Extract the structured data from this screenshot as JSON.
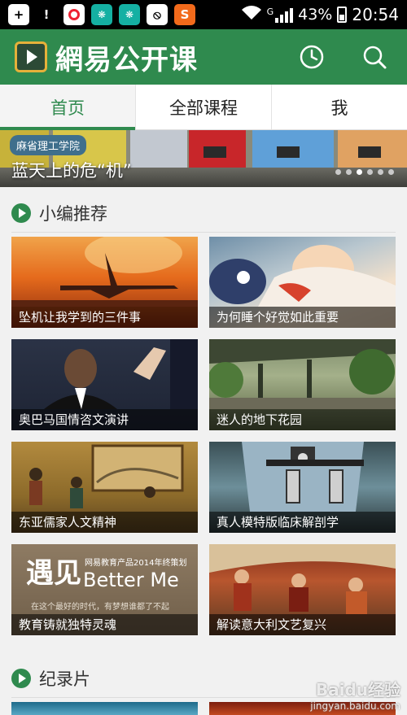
{
  "status_bar": {
    "battery": "43%",
    "time": "20:54",
    "signal_label": "G"
  },
  "app": {
    "title": "網易公开课",
    "icons": [
      "history-icon",
      "search-icon"
    ]
  },
  "tabs": [
    {
      "label": "首页",
      "active": true
    },
    {
      "label": "全部课程",
      "active": false
    },
    {
      "label": "我",
      "active": false
    }
  ],
  "banner": {
    "tag": "麻省理工学院",
    "title": "蓝天上的危“机”",
    "dots": 6,
    "active_dot": 3
  },
  "sections": [
    {
      "title": "小编推荐",
      "items": [
        {
          "caption": "坠机让我学到的三件事"
        },
        {
          "caption": "为何睡个好觉如此重要"
        },
        {
          "caption": "奥巴马国情咨文演讲"
        },
        {
          "caption": "迷人的地下花园"
        },
        {
          "caption": "东亚儒家人文精神"
        },
        {
          "caption": "真人模特版临床解剖学"
        },
        {
          "caption": "教育铸就独特灵魂"
        },
        {
          "caption": "解读意大利文艺复兴"
        }
      ]
    },
    {
      "title": "纪录片",
      "items": []
    }
  ],
  "promo_image": {
    "big_char": "遇见",
    "subtitle": "网易教育产品2014年终策划",
    "title": "Better Me",
    "slogan": "在这个最好的时代，有梦想谁都了不起"
  },
  "watermark": {
    "brand": "Baidu经验",
    "url": "jingyan.baidu.com"
  },
  "colors": {
    "brand_green": "#2f8a4e",
    "status_bar": "#000000"
  }
}
